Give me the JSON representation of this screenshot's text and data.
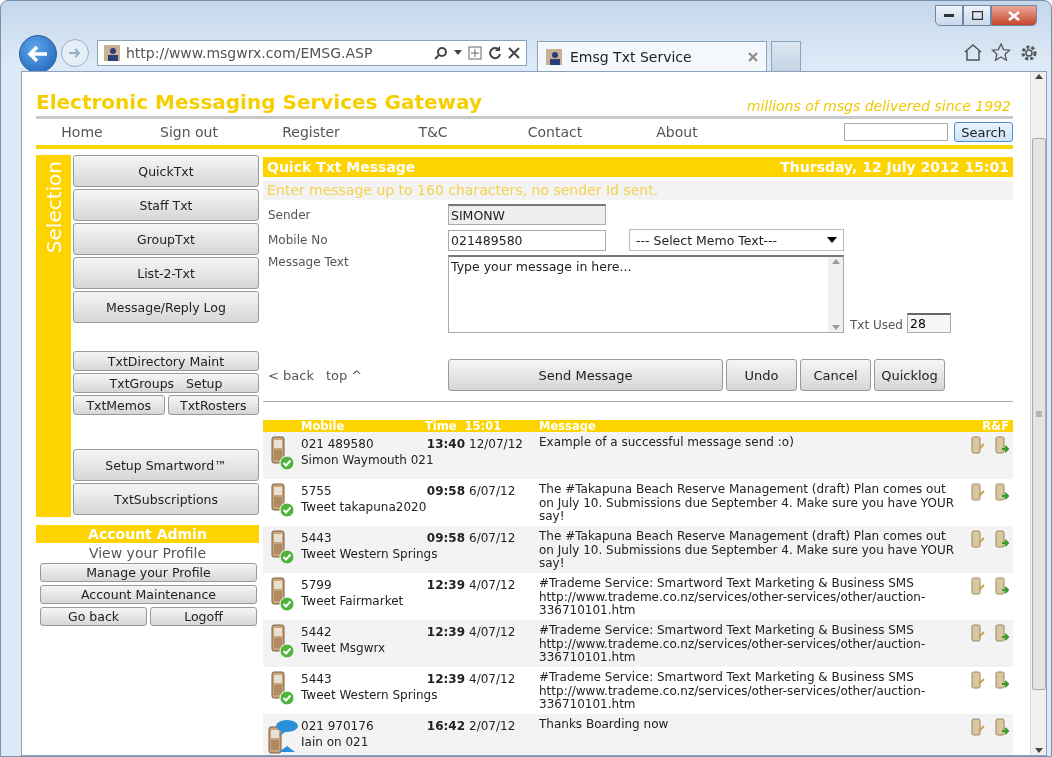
{
  "browser": {
    "url": "http://www.msgwrx.com/EMSG.ASP",
    "tab_title": "Emsg Txt Service"
  },
  "header": {
    "title": "Electronic Messaging Services Gateway",
    "tagline": "millions of msgs delivered since 1992"
  },
  "nav": [
    "Home",
    "Sign out",
    "Register",
    "T&C",
    "Contact",
    "About"
  ],
  "search": {
    "button": "Search"
  },
  "sidebar": {
    "heading": "Selection",
    "primary_buttons": [
      "QuickTxt",
      "Staff Txt",
      "GroupTxt",
      "List-2-Txt",
      "Message/Reply Log"
    ],
    "secondary_buttons": [
      [
        "TxtDirectory Maint"
      ],
      [
        "TxtGroups   Setup"
      ],
      [
        "TxtMemos",
        "TxtRosters"
      ]
    ],
    "extra_buttons": [
      "Setup Smartword™",
      "TxtSubscriptions"
    ]
  },
  "account": {
    "heading": "Account Admin",
    "link": "View your Profile",
    "buttons": [
      [
        "Manage your Profile"
      ],
      [
        "Account Maintenance"
      ],
      [
        "Go back",
        "Logoff"
      ]
    ]
  },
  "form": {
    "title": "Quick Txt Message",
    "date": "Thursday, 12 July 2012 15:01",
    "hint": "Enter message up to 160 characters, no sender Id sent.",
    "fields": [
      {
        "label": "Sender",
        "value": "SIMONW",
        "readonly": true
      },
      {
        "label": "Mobile No",
        "value": "021489580",
        "readonly": false
      }
    ],
    "memo_select": "--- Select Memo Text---",
    "message_label": "Message Text",
    "message": "Type your message in here...",
    "txt_used_label": "Txt Used",
    "txt_used": "28",
    "links": [
      "< back",
      "top ^"
    ],
    "buttons": [
      "Send Message",
      "Undo",
      "Cancel",
      "Quicklog"
    ]
  },
  "log": {
    "columns": [
      "Mobile",
      "Time  15:01",
      "Message",
      "R&F"
    ],
    "rows": [
      {
        "kind": "sent",
        "mobile": "021 489580",
        "name": "Simon Waymouth 021",
        "time": "13:40",
        "date": "12/07/12",
        "message": "Example of a successful message send :o)"
      },
      {
        "kind": "sent",
        "mobile": "5755",
        "name": "Tweet takapuna2020",
        "time": "09:58",
        "date": "6/07/12",
        "message": "The #Takapuna Beach Reserve Management (draft) Plan comes out on July 10. Submissions due September 4. Make sure you have YOUR say!"
      },
      {
        "kind": "sent",
        "mobile": "5443",
        "name": "Tweet Western Springs",
        "time": "09:58",
        "date": "6/07/12",
        "message": "The #Takapuna Beach Reserve Management (draft) Plan comes out on July 10. Submissions due September 4. Make sure you have YOUR say!"
      },
      {
        "kind": "sent",
        "mobile": "5799",
        "name": "Tweet Fairmarket",
        "time": "12:39",
        "date": "4/07/12",
        "message": "#Trademe Service: Smartword Text Marketing & Business SMS http://www.trademe.co.nz/services/other-services/other/auction-336710101.htm"
      },
      {
        "kind": "sent",
        "mobile": "5442",
        "name": "Tweet Msgwrx",
        "time": "12:39",
        "date": "4/07/12",
        "message": "#Trademe Service: Smartword Text Marketing & Business SMS http://www.trademe.co.nz/services/other-services/other/auction-336710101.htm"
      },
      {
        "kind": "sent",
        "mobile": "5443",
        "name": "Tweet Western Springs",
        "time": "12:39",
        "date": "4/07/12",
        "message": "#Trademe Service: Smartword Text Marketing & Business SMS http://www.trademe.co.nz/services/other-services/other/auction-336710101.htm"
      },
      {
        "kind": "reply",
        "mobile": "021 970176",
        "name": "Iain on 021",
        "time": "16:42",
        "date": "2/07/12",
        "message": "Thanks Boarding now"
      }
    ]
  }
}
